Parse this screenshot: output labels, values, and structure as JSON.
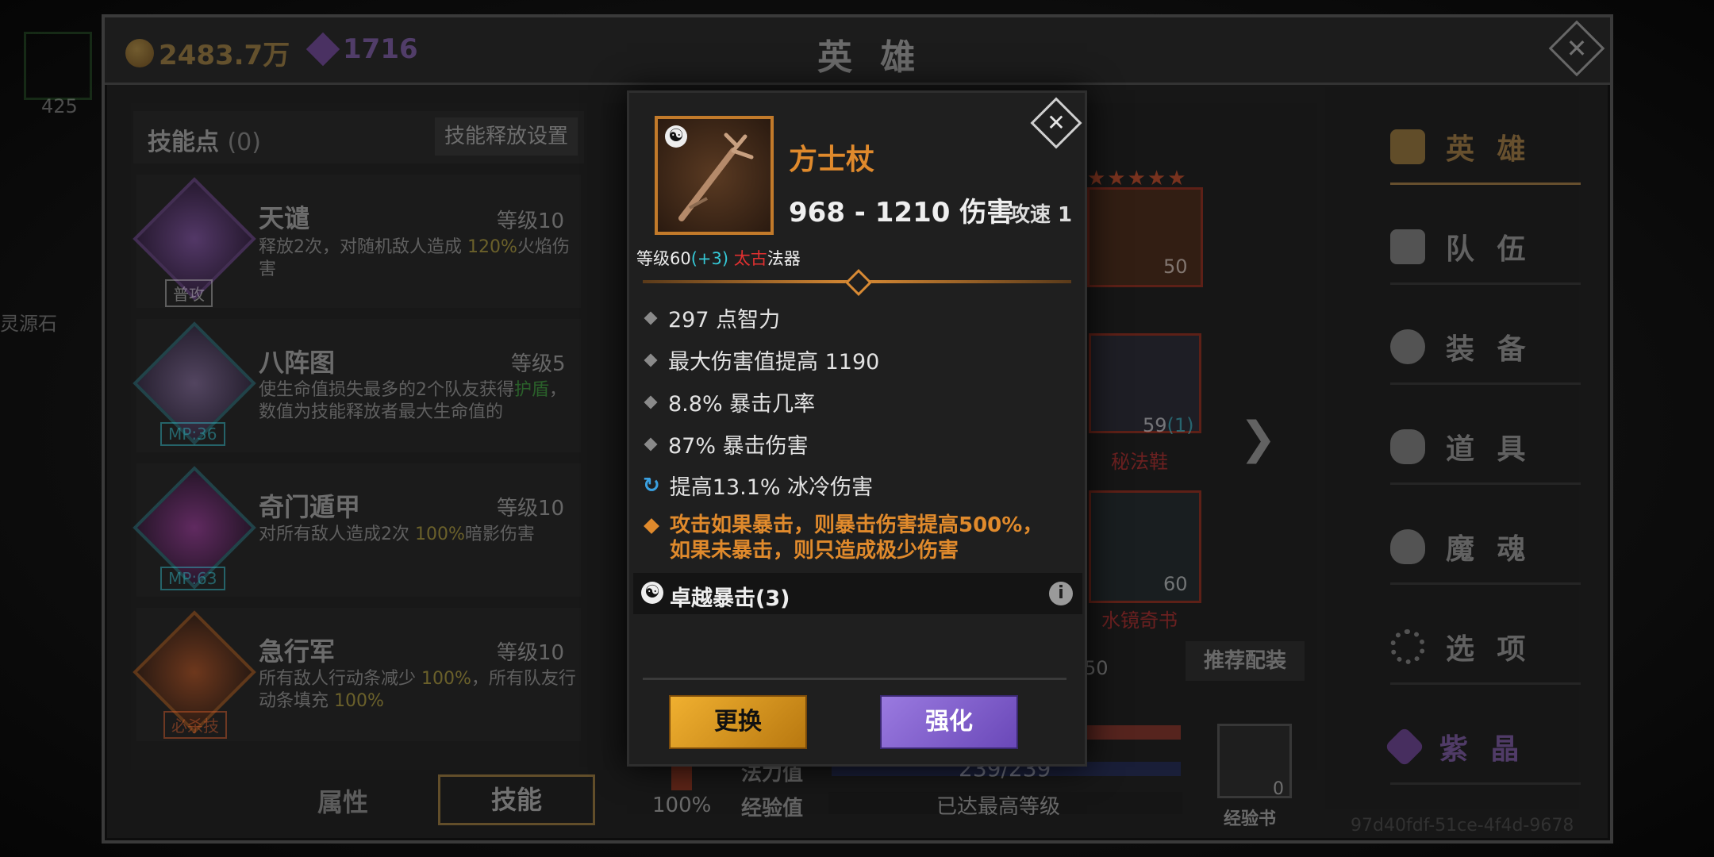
{
  "header": {
    "gold": "2483.7万",
    "gems": "1716",
    "title": "英 雄",
    "close_icon": "close-icon"
  },
  "outer_left": {
    "number": "425",
    "text": "灵源石"
  },
  "skills_panel": {
    "points_label": "技能点",
    "points_value": "(0)",
    "release_settings": "技能释放设置",
    "skills": [
      {
        "name": "天谴",
        "level": "等级10",
        "desc_a": "释放2次，对随机敌人造成 ",
        "desc_hl": "120%",
        "desc_b": "火焰伤害",
        "tag": "普攻",
        "icon": "skill-tianqian-icon"
      },
      {
        "name": "八阵图",
        "level": "等级5",
        "desc_a": "使生命值损失最多的2个队友获得",
        "desc_hl": "护盾",
        "desc_b": "，数值为技能释放者最大生命值的",
        "tag": "MP:36",
        "icon": "skill-bazhentu-icon"
      },
      {
        "name": "奇门遁甲",
        "level": "等级10",
        "desc_a": "对所有敌人造成2次 ",
        "desc_hl": "100%",
        "desc_b": "暗影伤害",
        "tag": "MP:63",
        "icon": "skill-qimen-icon"
      },
      {
        "name": "急行军",
        "level": "等级10",
        "desc_a": "所有敌人行动条减少 ",
        "desc_hl": "100%",
        "desc_b": "，所有队友行动条填充 ",
        "desc_hl2": "100%",
        "tag": "必杀技",
        "icon": "skill-jixingjun-icon"
      }
    ],
    "tabs": [
      "属性",
      "技能"
    ]
  },
  "hero_area": {
    "hero_level": "50",
    "boots_level": "59",
    "boots_bonus": "(1)",
    "boots_name": "秘法鞋",
    "book_level": "60",
    "book_name": "水镜奇书",
    "recommend": "推荐配装",
    "mana_label": "法力值",
    "mana_value": "239/239",
    "exp_label": "经验值",
    "exp_value": "已达最高等级",
    "percent": "100%",
    "exp_book_count": "0",
    "exp_book_label": "经验书",
    "hp_partial": "50",
    "uuid": "97d40fdf-51ce-4f4d-9678"
  },
  "right_nav": {
    "items": [
      "英 雄",
      "队 伍",
      "装 备",
      "道 具",
      "魔 魂",
      "选 项",
      "紫 晶"
    ]
  },
  "popup": {
    "item_name": "方士杖",
    "damage": "968 - 1210 伤害",
    "attack_speed": "攻速 1",
    "level_prefix": "等级60",
    "level_bonus": "(+3)",
    "rarity": "太古",
    "category": "法器",
    "stats": [
      "297 点智力",
      "最大伤害值提高 1190",
      "8.8% 暴击几率",
      "87% 暴击伤害"
    ],
    "special_stat": "提高13.1% 冰冷伤害",
    "legendary_line1": "攻击如果暴击，则暴击伤害提高500%，",
    "legendary_line2": "如果未暴击，则只造成极少伤害",
    "set_name": "卓越暴击(3)",
    "replace_button": "更换",
    "upgrade_button": "强化"
  },
  "colors": {
    "gold": "#c99a45",
    "purple": "#9b6bd4",
    "orange": "#e08a2c",
    "cyan": "#35c8d6",
    "red": "#e03030",
    "green": "#3fbf3f"
  }
}
